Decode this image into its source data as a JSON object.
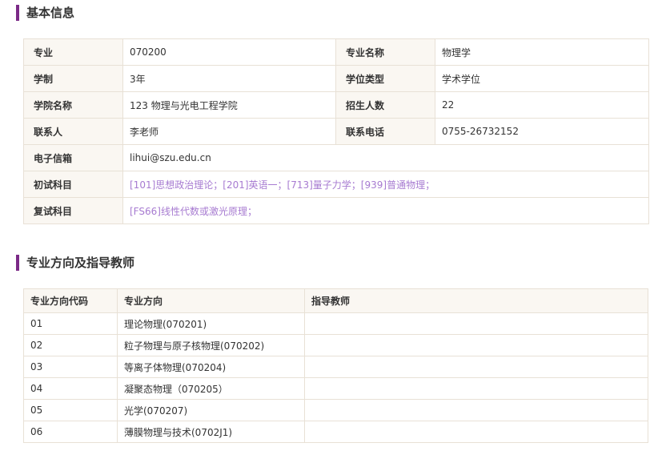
{
  "basic_info": {
    "title": "基本信息",
    "rows": [
      {
        "l1": "专业",
        "v1": "070200",
        "l2": "专业名称",
        "v2": "物理学"
      },
      {
        "l1": "学制",
        "v1": "3年",
        "l2": "学位类型",
        "v2": "学术学位"
      },
      {
        "l1": "学院名称",
        "v1": "123 物理与光电工程学院",
        "l2": "招生人数",
        "v2": "22"
      },
      {
        "l1": "联系人",
        "v1": "李老师",
        "l2": "联系电话",
        "v2": "0755-26732152"
      }
    ],
    "email_label": "电子信箱",
    "email": "lihui@szu.edu.cn",
    "prelim_label": "初试科目",
    "prelim": "[101]思想政治理论；[201]英语一；[713]量子力学；[939]普通物理；",
    "retest_label": "复试科目",
    "retest": "[FS66]线性代数或激光原理；",
    "link_color": "#a77bd1"
  },
  "directions": {
    "title": "专业方向及指导教师",
    "headers": [
      "专业方向代码",
      "专业方向",
      "指导教师"
    ],
    "rows": [
      {
        "code": "01",
        "name": "理论物理(070201)",
        "advisor": ""
      },
      {
        "code": "02",
        "name": "粒子物理与原子核物理(070202)",
        "advisor": ""
      },
      {
        "code": "03",
        "name": "等离子体物理(070204)",
        "advisor": ""
      },
      {
        "code": "04",
        "name": "凝聚态物理（070205）",
        "advisor": ""
      },
      {
        "code": "05",
        "name": "光学(070207)",
        "advisor": ""
      },
      {
        "code": "06",
        "name": "薄膜物理与技术(0702J1)",
        "advisor": ""
      }
    ]
  },
  "accent_color": "#7b2a87"
}
